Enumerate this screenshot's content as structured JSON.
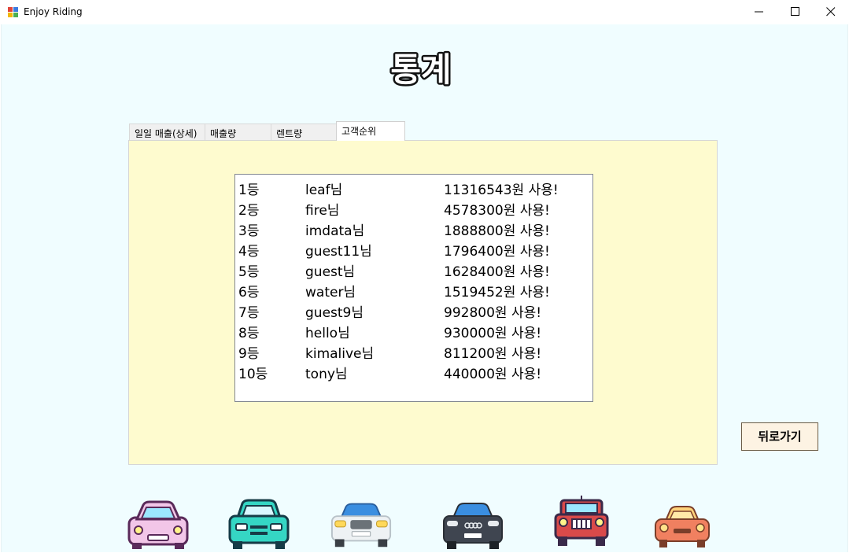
{
  "window": {
    "title": "Enjoy Riding"
  },
  "page": {
    "heading": "통계"
  },
  "tabs": [
    {
      "label": "일일 매출(상세)"
    },
    {
      "label": "매출량"
    },
    {
      "label": "렌트량"
    },
    {
      "label": "고객순위",
      "selected": true
    }
  ],
  "ranking": [
    {
      "rank": "1등",
      "name": "leaf님",
      "amount": "11316543원 사용!"
    },
    {
      "rank": "2등",
      "name": "fire님",
      "amount": "4578300원 사용!"
    },
    {
      "rank": "3등",
      "name": "imdata님",
      "amount": "1888800원 사용!"
    },
    {
      "rank": "4등",
      "name": "guest11님",
      "amount": "1796400원 사용!"
    },
    {
      "rank": "5등",
      "name": "guest님",
      "amount": "1628400원 사용!"
    },
    {
      "rank": "6등",
      "name": "water님",
      "amount": "1519452원 사용!"
    },
    {
      "rank": "7등",
      "name": "guest9님",
      "amount": "992800원 사용!"
    },
    {
      "rank": "8등",
      "name": "hello님",
      "amount": "930000원 사용!"
    },
    {
      "rank": "9등",
      "name": "kimalive님",
      "amount": "811200원 사용!"
    },
    {
      "rank": "10등",
      "name": "tony님",
      "amount": "440000원 사용!"
    }
  ],
  "buttons": {
    "back": "뒤로가기"
  },
  "cars": [
    {
      "icon": "car-icon",
      "color": "#f2c6e8"
    },
    {
      "icon": "car-icon",
      "color": "#35d6c4"
    },
    {
      "icon": "car-icon",
      "color": "#eef2f4"
    },
    {
      "icon": "car-icon",
      "color": "#3f4550"
    },
    {
      "icon": "car-icon",
      "color": "#d94a4a"
    },
    {
      "icon": "car-icon",
      "color": "#f08060"
    }
  ],
  "colors": {
    "background": "#f0fdff",
    "panel": "#fefbcf",
    "button": "#fdf3e3"
  }
}
